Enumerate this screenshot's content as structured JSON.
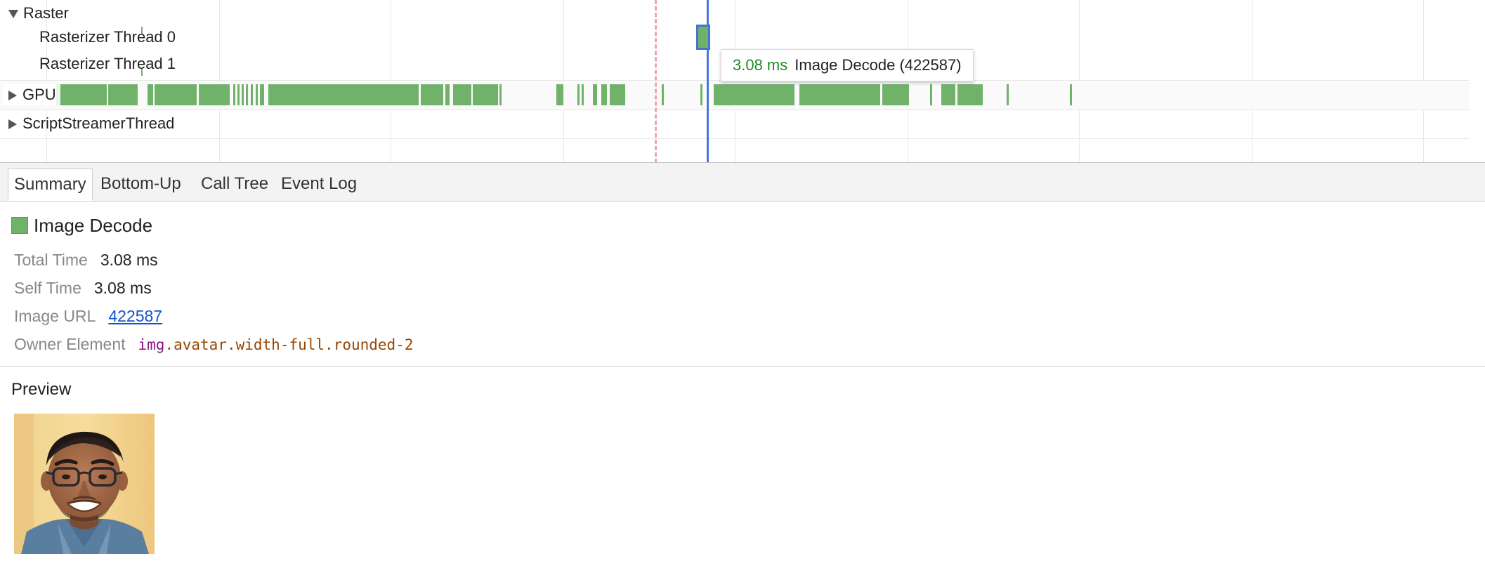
{
  "flame": {
    "tracks": {
      "raster": "Raster",
      "rasterizer0": "Rasterizer Thread 0",
      "rasterizer1": "Rasterizer Thread 1",
      "gpu": "GPU",
      "script_streamer": "ScriptStreamerThread"
    },
    "tooltip": {
      "time": "3.08 ms",
      "name": "Image Decode (422587)"
    }
  },
  "tabs": [
    {
      "label": "Summary",
      "active": true
    },
    {
      "label": "Bottom-Up",
      "active": false
    },
    {
      "label": "Call Tree",
      "active": false
    },
    {
      "label": "Event Log",
      "active": false
    }
  ],
  "summary": {
    "category": "Image Decode",
    "category_color": "#71b26a",
    "rows": {
      "total_time": {
        "key": "Total Time",
        "value": "3.08 ms"
      },
      "self_time": {
        "key": "Self Time",
        "value": "3.08 ms"
      },
      "image_url": {
        "key": "Image URL",
        "value": "422587"
      },
      "owner_element": {
        "key": "Owner Element",
        "tag": "img",
        "classes": ".avatar.width-full.rounded-2"
      }
    }
  },
  "preview": {
    "title": "Preview",
    "image": "portrait-photo"
  },
  "colors": {
    "event_green": "#71b26a",
    "selection_blue": "#4879d6",
    "marker_red": "#f1a3ab",
    "tooltip_time_green": "#228b22",
    "link_blue": "#1155cc"
  }
}
